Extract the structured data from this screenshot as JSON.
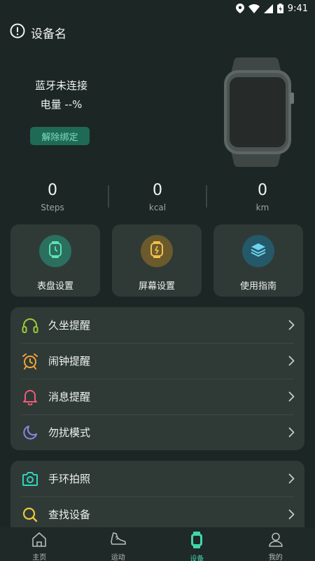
{
  "status_bar": {
    "time": "9:41",
    "icons": [
      "location-icon",
      "wifi-icon",
      "signal-icon",
      "battery-charging-icon"
    ]
  },
  "header": {
    "icon": "alert-circle-icon",
    "title": "设备名"
  },
  "device": {
    "bluetooth_status": "蓝牙未连接",
    "battery_text": "电量 --%",
    "unbind_label": "解除绑定",
    "image": "smartwatch-illustration"
  },
  "stats": [
    {
      "value": "0",
      "unit": "Steps"
    },
    {
      "value": "0",
      "unit": "kcal"
    },
    {
      "value": "0",
      "unit": "km"
    }
  ],
  "quick_actions": [
    {
      "label": "表盘设置",
      "icon": "watch-face-icon",
      "circle_color": "#2b6f5e",
      "icon_color": "#5de3b2"
    },
    {
      "label": "屏幕设置",
      "icon": "screen-settings-icon",
      "circle_color": "#6b5a2c",
      "icon_color": "#f2c04a"
    },
    {
      "label": "使用指南",
      "icon": "layers-icon",
      "circle_color": "#24596a",
      "icon_color": "#6fd2ee"
    }
  ],
  "reminders_menu": [
    {
      "label": "久坐提醒",
      "icon": "headphones-icon",
      "color": "#9ccc34"
    },
    {
      "label": "闹钟提醒",
      "icon": "alarm-clock-icon",
      "color": "#f3a436"
    },
    {
      "label": "消息提醒",
      "icon": "bell-icon",
      "color": "#ef5a78"
    },
    {
      "label": "勿扰模式",
      "icon": "moon-icon",
      "color": "#8b87e0"
    }
  ],
  "tools_menu": [
    {
      "label": "手环拍照",
      "icon": "camera-icon",
      "color": "#2fd4bf"
    },
    {
      "label": "查找设备",
      "icon": "search-icon",
      "color": "#f0c73a"
    }
  ],
  "tabbar": [
    {
      "label": "主页",
      "icon": "home-icon",
      "active": false
    },
    {
      "label": "运动",
      "icon": "sneaker-icon",
      "active": false
    },
    {
      "label": "设备",
      "icon": "watch-icon",
      "active": true
    },
    {
      "label": "我的",
      "icon": "user-icon",
      "active": false
    }
  ],
  "colors": {
    "background": "#1c2624",
    "card": "#2f3a37",
    "accent": "#3fd6a8",
    "unbind_button": "#1f6a55"
  }
}
